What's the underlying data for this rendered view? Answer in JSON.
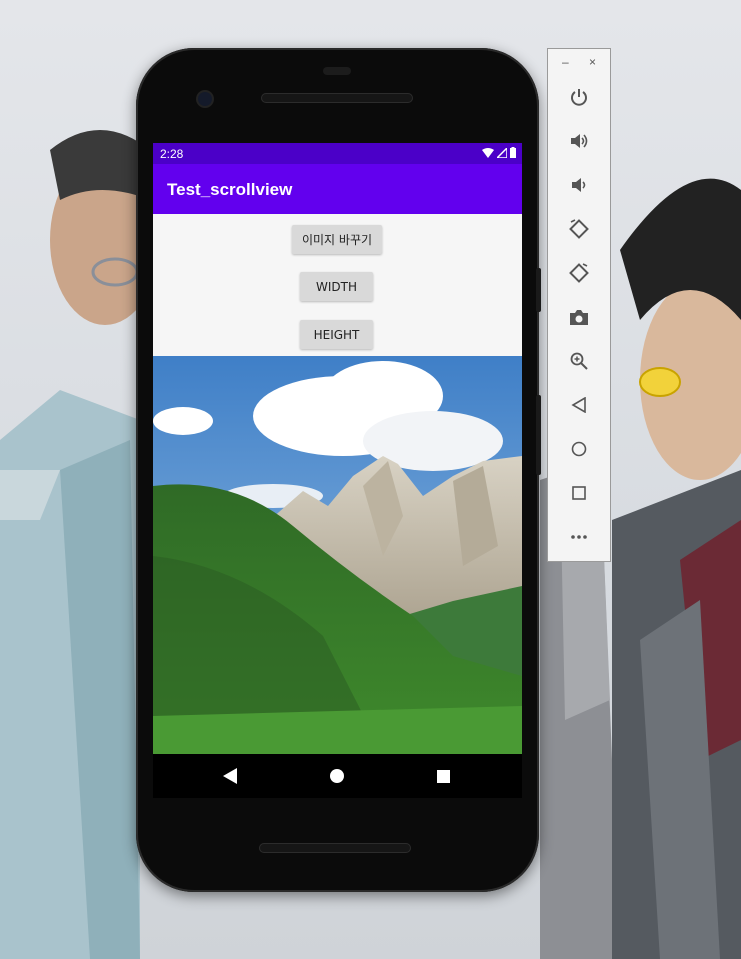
{
  "status_bar": {
    "time": "2:28"
  },
  "app": {
    "title": "Test_scrollview"
  },
  "buttons": {
    "change_image": "이미지 바꾸기",
    "width": "WIDTH",
    "height": "HEIGHT"
  },
  "nav_bar": {
    "back_icon": "back-triangle-icon",
    "home_icon": "home-circle-icon",
    "recents_icon": "recents-square-icon"
  },
  "emulator_toolbar": {
    "minimize": "–",
    "close": "×",
    "items": [
      "power-icon",
      "volume-up-icon",
      "volume-down-icon",
      "rotate-left-icon",
      "rotate-right-icon",
      "camera-icon",
      "zoom-icon",
      "back-icon",
      "home-icon",
      "overview-icon",
      "more-icon"
    ]
  },
  "colors": {
    "status_bar": "#4b00c8",
    "app_bar": "#6200ee",
    "button": "#d9d9d9"
  }
}
